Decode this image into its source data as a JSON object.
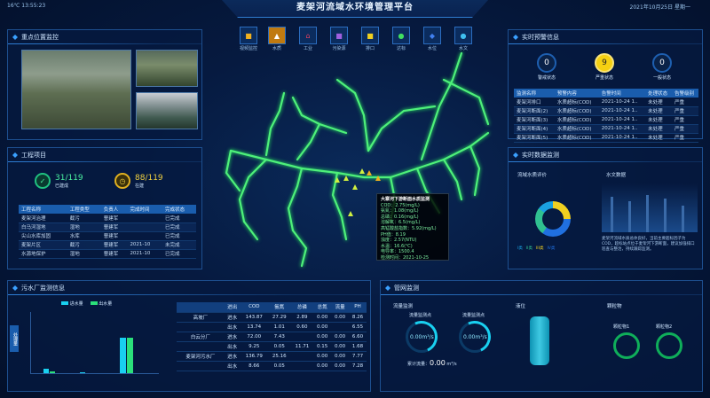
{
  "header": {
    "title": "麦架河流域水环境管理平台",
    "left_info": "16℃    13:55:23",
    "right_info": "2021年10月25日     星期一"
  },
  "toolbar": [
    {
      "label": "视频监控",
      "icon": "camera-icon"
    },
    {
      "label": "水质",
      "icon": "flask-icon"
    },
    {
      "label": "工业",
      "icon": "factory-icon"
    },
    {
      "label": "污染源",
      "icon": "pollution-icon"
    },
    {
      "label": "排口",
      "icon": "outlet-icon"
    },
    {
      "label": "达标",
      "icon": "check-icon"
    },
    {
      "label": "水位",
      "icon": "level-icon"
    },
    {
      "label": "水文",
      "icon": "drop-icon"
    }
  ],
  "video_panel": {
    "title": "重点位置监控"
  },
  "project_panel": {
    "title": "工程项目",
    "stat1": {
      "value": "31/119",
      "label": "已建成"
    },
    "stat2": {
      "value": "88/119",
      "label": "在建"
    },
    "columns": [
      "工程名称",
      "工程类型",
      "负责人",
      "完成时间",
      "完成状态"
    ],
    "rows": [
      [
        "麦架河治理",
        "截污",
        "曹建军",
        "",
        "已完成"
      ],
      [
        "白马河湿地",
        "湿地",
        "曹建军",
        "",
        "已完成"
      ],
      [
        "尖山水库加固",
        "水库",
        "曹建军",
        "",
        "已完成"
      ],
      [
        "麦架片区",
        "截污",
        "曹建军",
        "2021-10",
        "未完成"
      ],
      [
        "水源地保护",
        "湿地",
        "曹建军",
        "2021-10",
        "已完成"
      ]
    ]
  },
  "alarm_panel": {
    "title": "实时预警信息",
    "stats": [
      {
        "value": "0",
        "label": "警戒状态"
      },
      {
        "value": "9",
        "label": "严重状态"
      },
      {
        "value": "0",
        "label": "一般状态"
      }
    ],
    "columns": [
      "监测名称",
      "预警内容",
      "告警时间",
      "处理状态",
      "告警级别"
    ],
    "rows": [
      [
        "麦架河排口",
        "水质超标(COD)",
        "2021-10-24 1..",
        "未处理",
        "严重"
      ],
      [
        "麦架河断面(2)",
        "水质超标(COD)",
        "2021-10-24 1..",
        "未处理",
        "严重"
      ],
      [
        "麦架河断面(3)",
        "水质超标(COD)",
        "2021-10-24 1..",
        "未处理",
        "严重"
      ],
      [
        "麦架河断面(4)",
        "水质超标(COD)",
        "2021-10-24 1..",
        "未处理",
        "严重"
      ],
      [
        "麦架河断面(5)",
        "水质超标(COD)",
        "2021-10-24 1..",
        "未处理",
        "严重"
      ]
    ]
  },
  "analysis_panel": {
    "title": "实时数据监测",
    "left_title": "流域水质评价",
    "right_title": "水文数据",
    "note": "麦架河流域水质总体良好，当前主要超标因子为COD，超标站点位于麦架河下游断面，建议加强排口巡查与整治，持续跟踪监测。",
    "legend": [
      "I类",
      "II类",
      "III类",
      "IV类"
    ]
  },
  "tooltip": {
    "title": "大寨河下游断面水质监测",
    "lines": [
      "COD：2.75(mg/L)",
      "氨氮：1.08(mg/L)",
      "总磷：0.16(mg/L)",
      "溶解氧：6.5(mg/L)",
      "高锰酸盐指数：5.92(mg/L)",
      "PH值：8.19",
      "浊度：2.57(NTU)",
      "水温：16.6(℃)",
      "电导率：1500.4",
      "检测时间：2021-10-25"
    ]
  },
  "sewage_panel": {
    "title": "污水厂监测信息",
    "legend": [
      "进水量",
      "出水量"
    ],
    "side_label": "处理量",
    "chart": {
      "labels": [
        "2.1",
        "0.8",
        "0.5",
        "8.1",
        "8.1"
      ]
    }
  },
  "water_table": {
    "columns": [
      "",
      "进出",
      "COD",
      "氨氮",
      "总磷",
      "总氮",
      "流量",
      "PH"
    ],
    "rows": [
      [
        "高坡厂",
        "进水",
        "143.87",
        "27.29",
        "2.89",
        "0.00",
        "0.00",
        "8.26"
      ],
      [
        "",
        "出水",
        "13.74",
        "1.01",
        "0.60",
        "0.00",
        "",
        "6.55"
      ],
      [
        "白云分厂",
        "进水",
        "72.00",
        "7.43",
        "",
        "0.00",
        "0.00",
        "6.60"
      ],
      [
        "",
        "出水",
        "9.25",
        "0.05",
        "11.71",
        "0.15",
        "0.00",
        "1.68"
      ],
      [
        "麦架河污水厂",
        "进水",
        "136.79",
        "25.16",
        "",
        "0.00",
        "0.00",
        "7.77"
      ],
      [
        "",
        "出水",
        "8.66",
        "0.05",
        "",
        "0.00",
        "0.00",
        "7.28"
      ]
    ]
  },
  "pump_panel": {
    "title": "管网监测",
    "sections": [
      {
        "title": "流量监测"
      },
      {
        "title": "液位"
      },
      {
        "title": "颗粒物"
      }
    ],
    "gauges": [
      {
        "label": "流量监测点",
        "value": "0.00",
        "unit": "m³/s"
      },
      {
        "label": "流量监测点",
        "value": "0.00",
        "unit": "m³/s"
      }
    ],
    "total_label": "累计流量：",
    "total_value": "0.00",
    "total_unit": "m³/s",
    "rings": [
      {
        "label": "颗粒物1"
      },
      {
        "label": "颗粒物2"
      }
    ]
  }
}
